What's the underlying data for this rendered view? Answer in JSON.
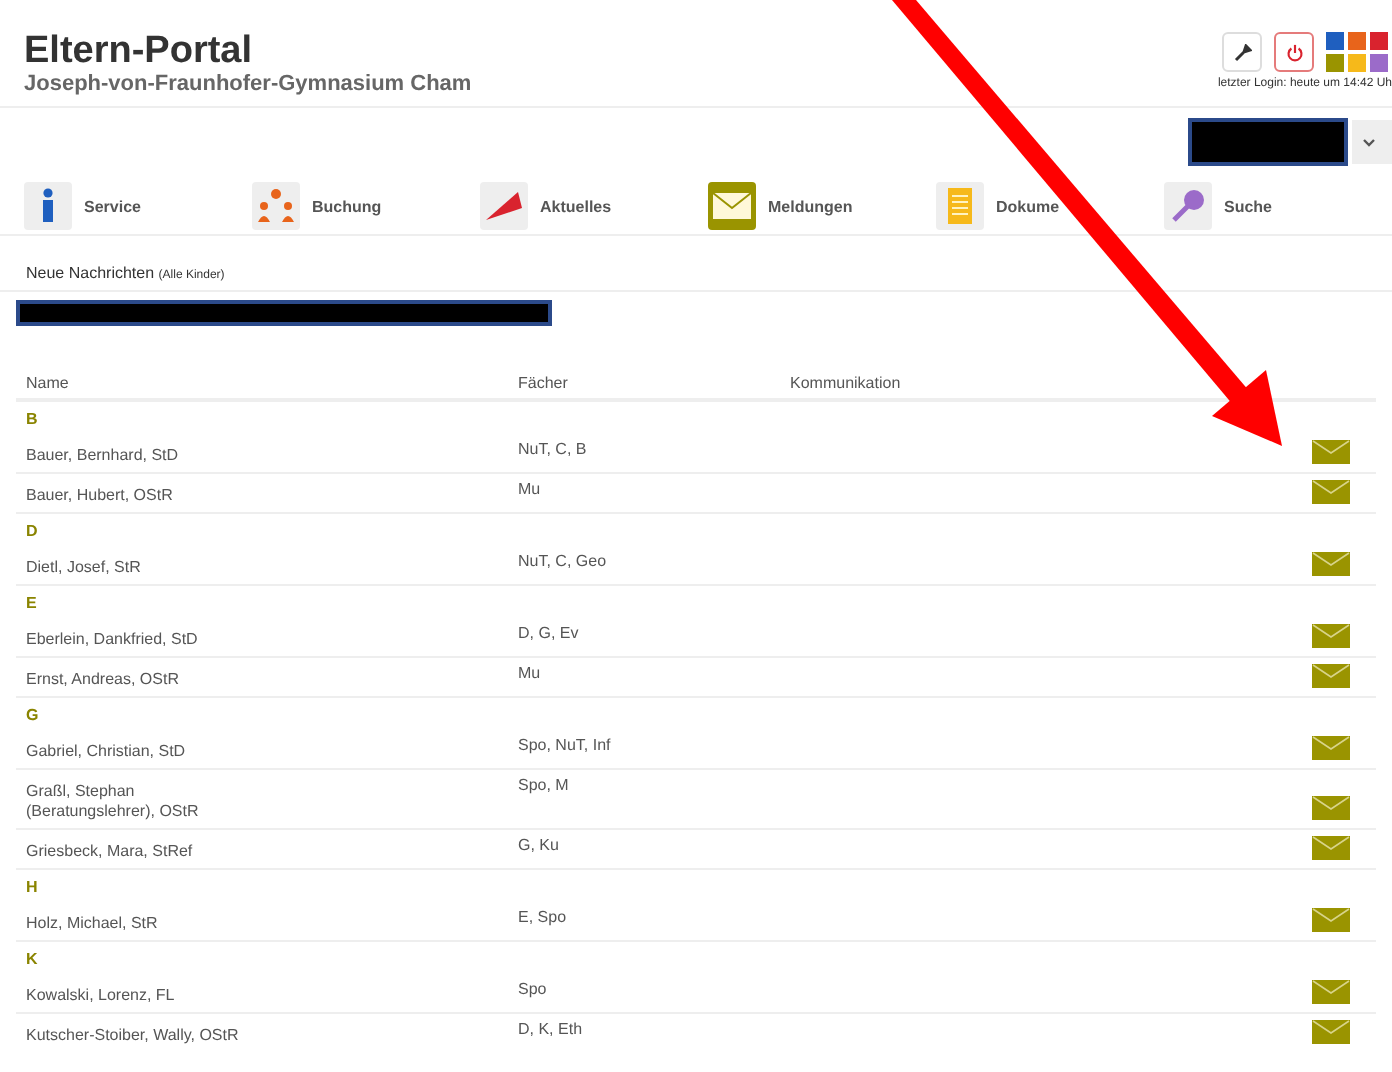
{
  "header": {
    "title": "Eltern-Portal",
    "subtitle": "Joseph-von-Fraunhofer-Gymnasium Cham",
    "last_login": "letzter Login: heute um 14:42 Uh"
  },
  "swatches": [
    {
      "color": "#1f5fbf"
    },
    {
      "color": "#e8641b"
    },
    {
      "color": "#d9232e"
    },
    {
      "color": "#9a9400"
    },
    {
      "color": "#f6b91a"
    },
    {
      "color": "#9b6bc9"
    }
  ],
  "nav": [
    {
      "label": "Service",
      "selected": false
    },
    {
      "label": "Buchung",
      "selected": false
    },
    {
      "label": "Aktuelles",
      "selected": false
    },
    {
      "label": "Meldungen",
      "selected": true
    },
    {
      "label": "Dokume",
      "selected": false
    },
    {
      "label": "Suche",
      "selected": false
    }
  ],
  "news": {
    "title": "Neue Nachrichten",
    "note": "(Alle Kinder)"
  },
  "table": {
    "columns": [
      "Name",
      "Fächer",
      "Kommunikation"
    ],
    "groups": [
      {
        "letter": "B",
        "rows": [
          {
            "name": "Bauer, Bernhard, StD",
            "subjects": "NuT, C, B"
          },
          {
            "name": "Bauer, Hubert, OStR",
            "subjects": "Mu"
          }
        ]
      },
      {
        "letter": "D",
        "rows": [
          {
            "name": "Dietl, Josef, StR",
            "subjects": "NuT, C, Geo"
          }
        ]
      },
      {
        "letter": "E",
        "rows": [
          {
            "name": "Eberlein, Dankfried, StD",
            "subjects": "D, G, Ev"
          },
          {
            "name": "Ernst, Andreas, OStR",
            "subjects": "Mu"
          }
        ]
      },
      {
        "letter": "G",
        "rows": [
          {
            "name": "Gabriel, Christian, StD",
            "subjects": "Spo, NuT, Inf"
          },
          {
            "name": "Graßl, Stephan (Beratungslehrer), OStR",
            "subjects": "Spo, M"
          },
          {
            "name": "Griesbeck, Mara, StRef",
            "subjects": "G, Ku"
          }
        ]
      },
      {
        "letter": "H",
        "rows": [
          {
            "name": "Holz, Michael, StR",
            "subjects": "E, Spo"
          }
        ]
      },
      {
        "letter": "K",
        "rows": [
          {
            "name": "Kowalski, Lorenz, FL",
            "subjects": "Spo"
          },
          {
            "name": "Kutscher-Stoiber, Wally, OStR",
            "subjects": "D, K, Eth"
          }
        ]
      }
    ]
  }
}
